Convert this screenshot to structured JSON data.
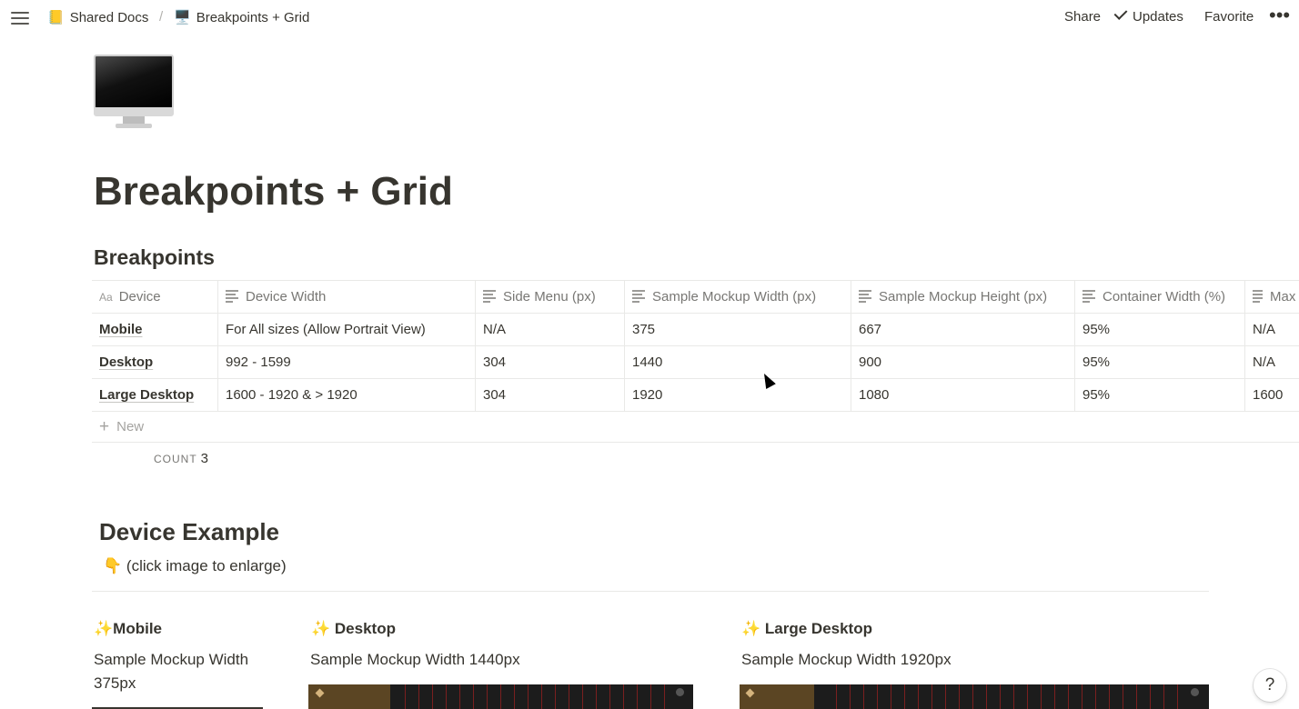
{
  "breadcrumb": {
    "workspace_emoji": "📒",
    "workspace": "Shared Docs",
    "separator": "/",
    "page_emoji": "🖥️",
    "page": "Breakpoints + Grid"
  },
  "topbar": {
    "share": "Share",
    "updates": "Updates",
    "favorite": "Favorite",
    "more": "•••"
  },
  "page": {
    "title": "Breakpoints + Grid",
    "section_heading": "Breakpoints"
  },
  "table": {
    "columns": [
      "Device",
      "Device Width",
      "Side Menu (px)",
      "Sample Mockup Width (px)",
      "Sample Mockup Height (px)",
      "Container Width (%)",
      "Max"
    ],
    "rows": [
      [
        "Mobile",
        "For All sizes (Allow Portrait View)",
        "N/A",
        "375",
        "667",
        "95%",
        "N/A"
      ],
      [
        "Desktop",
        "992 - 1599",
        "304",
        "1440",
        "900",
        "95%",
        "N/A"
      ],
      [
        "Large Desktop",
        "1600 - 1920 & > 1920",
        "304",
        "1920",
        "1080",
        "95%",
        "1600"
      ]
    ],
    "new_label": "New",
    "count_label": "COUNT",
    "count_value": "3"
  },
  "examples": {
    "heading": "Device Example",
    "hint_emoji": "👇",
    "hint": "(click image to enlarge)",
    "sparkle": "✨",
    "cols": [
      {
        "title": "Mobile",
        "text": "Sample Mockup Width 375px"
      },
      {
        "title": " Desktop",
        "text": "Sample Mockup Width 1440px"
      },
      {
        "title": " Large Desktop",
        "text": "Sample Mockup Width 1920px"
      }
    ]
  },
  "help": "?"
}
